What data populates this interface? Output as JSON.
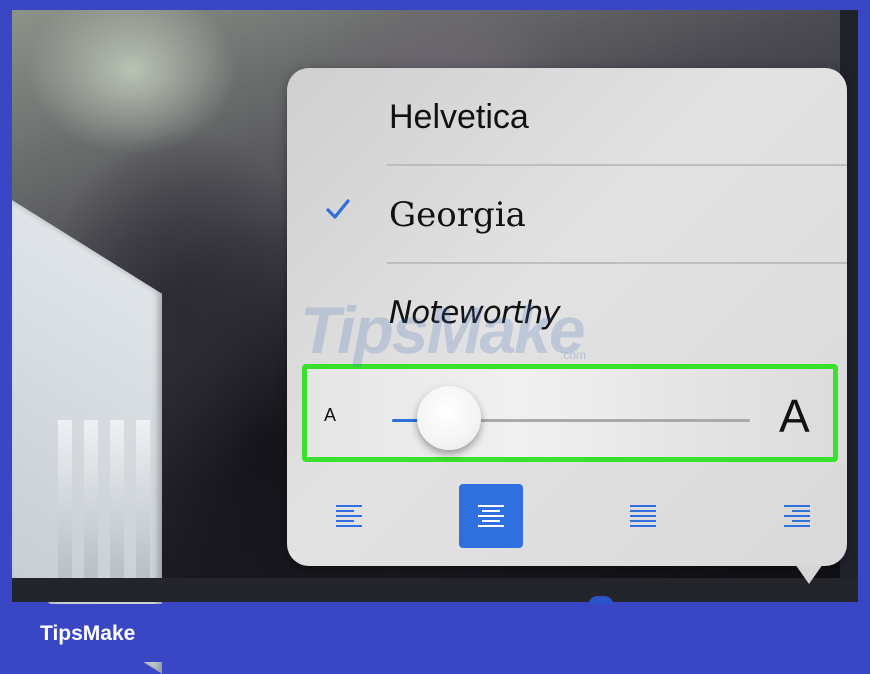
{
  "font_menu": {
    "fonts": [
      {
        "label": "Helvetica",
        "selected": false
      },
      {
        "label": "Georgia",
        "selected": true
      },
      {
        "label": "Noteworthy",
        "selected": false
      }
    ],
    "check_icon": "checkmark-icon"
  },
  "text_size": {
    "small_label": "A",
    "large_label": "A",
    "value": 0.16
  },
  "alignment": {
    "options": [
      "align-left",
      "align-center",
      "align-justify",
      "align-right"
    ],
    "selected": "align-center"
  },
  "colors": {
    "accent": "#2f6fde",
    "highlight": "#39e02c",
    "brand_bar": "#3a47c4"
  },
  "watermark": {
    "text": "TipsMake",
    "suffix": ".com"
  },
  "footer": {
    "brand": "TipsMake"
  }
}
